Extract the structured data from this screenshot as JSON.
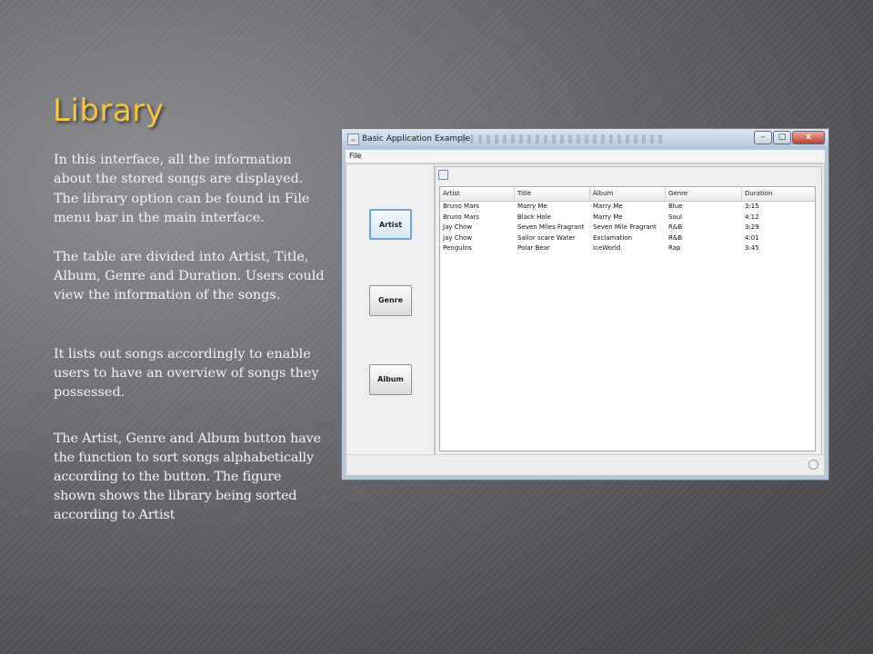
{
  "slide": {
    "title": "Library",
    "paragraphs": [
      "In this interface, all the information about the stored songs are displayed.",
      "The library option can be found in File menu bar in the main interface.",
      "The table are divided into Artist, Title, Album, Genre and Duration. Users could view the information of the songs.",
      "It lists out songs accordingly to enable users to have an overview of songs they possessed.",
      "The Artist, Genre and Album button have the function to sort songs alphabetically according to the button. The figure shown shows the library being sorted according to Artist"
    ]
  },
  "app_window": {
    "title": "Basic Application Example",
    "menu": {
      "file": "File"
    },
    "controls": {
      "minimize": "–",
      "maximize": "□",
      "close": "x"
    },
    "sort_buttons": {
      "artist": "Artist",
      "genre": "Genre",
      "album": "Album"
    },
    "table": {
      "columns": [
        "Artist",
        "Title",
        "Album",
        "Genre",
        "Duration"
      ],
      "rows": [
        [
          "Bruno Mars",
          "Marry Me",
          "Marry Me",
          "Blue",
          "3:15"
        ],
        [
          "Bruno Mars",
          "Black Hole",
          "Marry Me",
          "Soul",
          "4:12"
        ],
        [
          "Jay Chow",
          "Seven Miles Fragrant",
          "Seven Mile Fragrant",
          "R&B",
          "3:29"
        ],
        [
          "Jay Chow",
          "Sailor scare Water",
          "Exclamation",
          "R&B",
          "4:01"
        ],
        [
          "Penguins",
          "Polar Bear",
          "IceWorld",
          "Rap",
          "3:45"
        ]
      ]
    }
  },
  "colors": {
    "title": "#f5c441",
    "body_text": "#f4f4f4",
    "background": "#6d6d72",
    "selected_button_border": "#6fa6d6"
  },
  "icons": {
    "app": "java-cup-icon",
    "status": "circle-icon"
  }
}
